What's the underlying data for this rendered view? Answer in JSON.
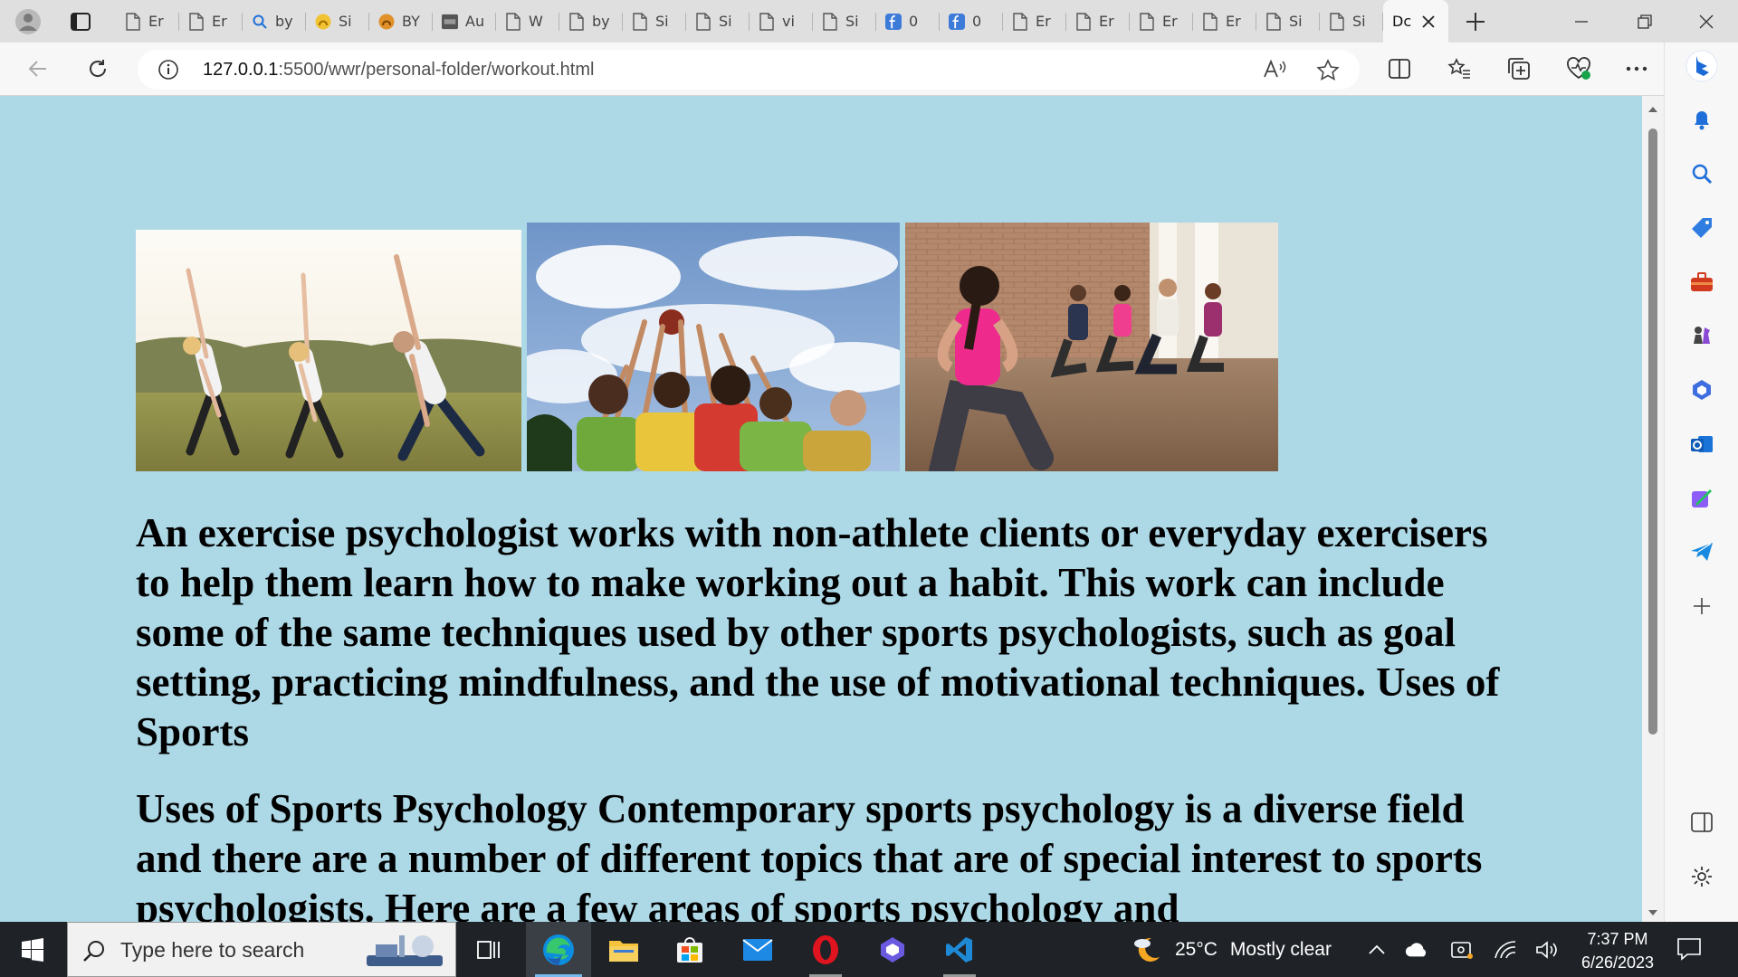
{
  "tabs": [
    {
      "label": "Er",
      "icon": "page-icon"
    },
    {
      "label": "Er",
      "icon": "page-icon"
    },
    {
      "label": "by",
      "icon": "search-icon"
    },
    {
      "label": "Si",
      "icon": "yellow-logo-icon"
    },
    {
      "label": "BY",
      "icon": "orange-logo-icon"
    },
    {
      "label": "Au",
      "icon": "ryu-icon"
    },
    {
      "label": "W",
      "icon": "page-icon"
    },
    {
      "label": "by",
      "icon": "page-icon"
    },
    {
      "label": "Si",
      "icon": "page-icon"
    },
    {
      "label": "Si",
      "icon": "page-icon"
    },
    {
      "label": "vi",
      "icon": "page-icon"
    },
    {
      "label": "Si",
      "icon": "page-icon"
    },
    {
      "label": "0",
      "icon": "f-logo-icon"
    },
    {
      "label": "0",
      "icon": "f-logo-icon"
    },
    {
      "label": "Er",
      "icon": "page-icon"
    },
    {
      "label": "Er",
      "icon": "page-icon"
    },
    {
      "label": "Er",
      "icon": "page-icon"
    },
    {
      "label": "Er",
      "icon": "page-icon"
    },
    {
      "label": "Si",
      "icon": "page-icon"
    },
    {
      "label": "Si",
      "icon": "page-icon"
    }
  ],
  "active_tab": {
    "label": "Dc"
  },
  "address": {
    "host": "127.0.0.1",
    "path": ":5500/wwr/personal-folder/workout.html"
  },
  "page": {
    "background": "#add8e6",
    "photos": [
      {
        "name": "group-stretching-outdoors-photo"
      },
      {
        "name": "kids-reaching-for-ball-photo"
      },
      {
        "name": "fitness-class-lunges-photo"
      }
    ],
    "paragraphs": [
      "An exercise psychologist works with non-athlete clients or everyday exercisers to help them learn how to make working out a habit. This work can include some of the same techniques used by other sports psychologists, such as goal setting, practicing mindfulness, and the use of motivational techniques. Uses of Sports",
      "Uses of Sports Psychology Contemporary sports psychology is a diverse field and there are a number of different topics that are of special interest to sports psychologists. Here are a few areas of sports psychology and"
    ]
  },
  "taskbar": {
    "search_placeholder": "Type here to search",
    "weather_temp": "25°C",
    "weather_text": "Mostly clear",
    "time": "7:37 PM",
    "date": "6/26/2023"
  }
}
